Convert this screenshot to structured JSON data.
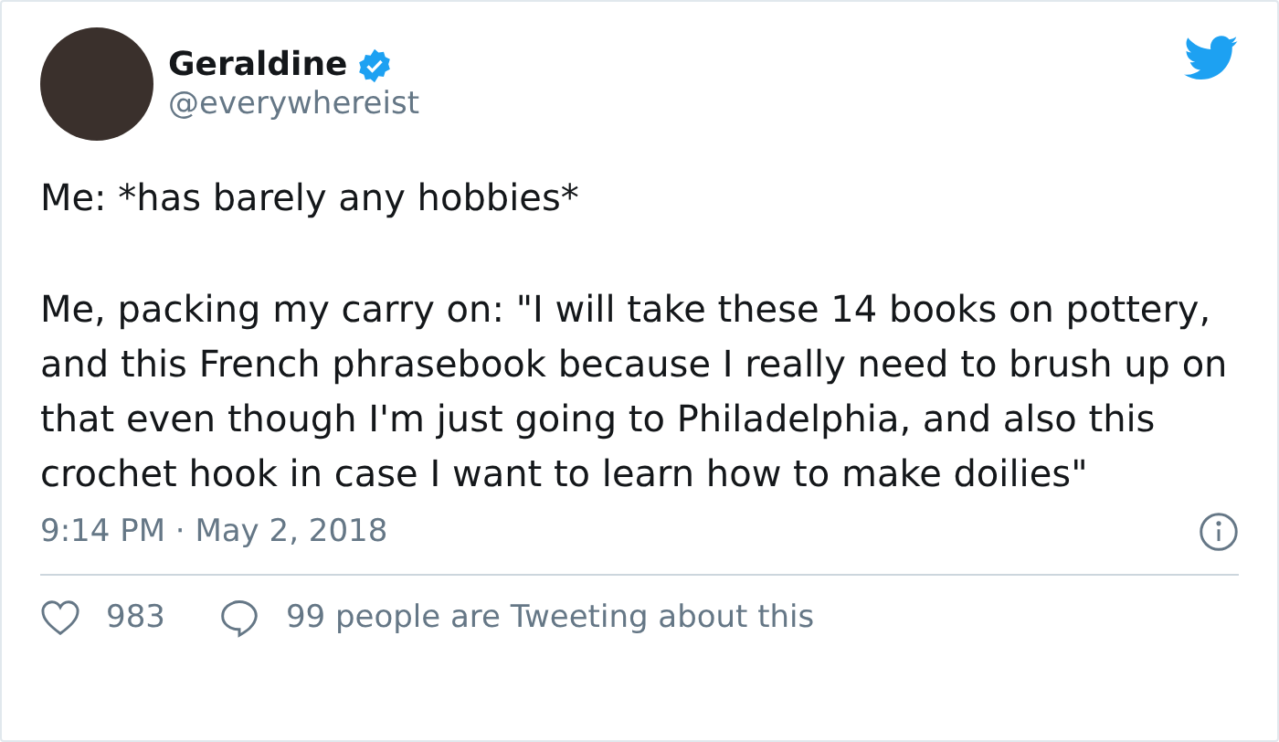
{
  "author": {
    "name": "Geraldine",
    "verified": true,
    "handle": "@everywhereist"
  },
  "paragraphs": [
    "Me: *has barely any hobbies*",
    "Me, packing my carry on: \"I will take these 14 books on pottery, and this French phrasebook because I really need to brush up on that even though I'm just going to Philadelphia, and also this crochet hook in case I want to learn how to make doilies\""
  ],
  "timestamp": "9:14 PM · May 2, 2018",
  "actions": [
    {
      "kind": "like",
      "label": "983"
    },
    {
      "kind": "reply",
      "label": "99 people are Tweeting about this"
    }
  ]
}
